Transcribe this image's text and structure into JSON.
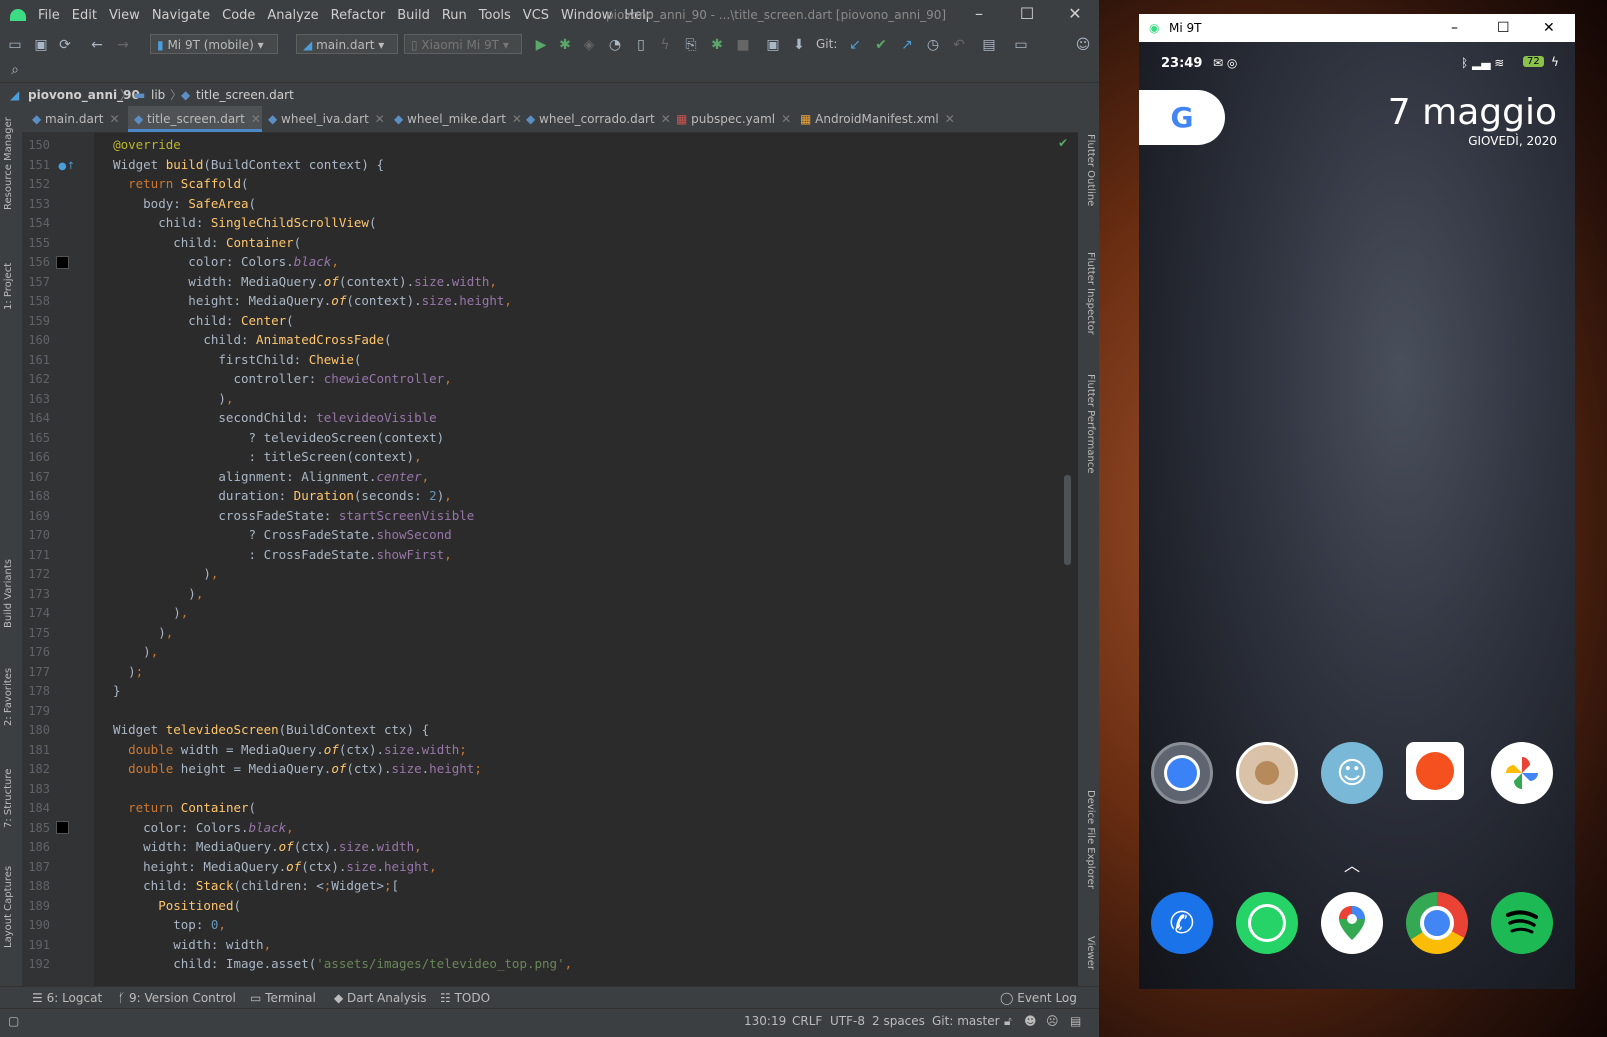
{
  "ide": {
    "menu": [
      "File",
      "Edit",
      "View",
      "Navigate",
      "Code",
      "Analyze",
      "Refactor",
      "Build",
      "Run",
      "Tools",
      "VCS",
      "Window",
      "Help"
    ],
    "window_title": "piovono_anni_90 - ...\\title_screen.dart [piovono_anni_90]",
    "toolbar": {
      "device_combo": "Mi 9T (mobile)",
      "config_combo": "main.dart",
      "target_combo": "Xiaomi Mi 9T",
      "git_label": "Git:"
    },
    "breadcrumb": [
      "piovono_anni_90",
      "lib",
      "title_screen.dart"
    ],
    "tabs": [
      {
        "label": "main.dart"
      },
      {
        "label": "title_screen.dart"
      },
      {
        "label": "wheel_iva.dart"
      },
      {
        "label": "wheel_mike.dart"
      },
      {
        "label": "wheel_corrado.dart"
      },
      {
        "label": "pubspec.yaml"
      },
      {
        "label": "AndroidManifest.xml"
      }
    ],
    "left_tools": [
      "Resource Manager",
      "1: Project",
      "Build Variants",
      "2: Favorites",
      "7: Structure",
      "Layout Captures"
    ],
    "right_tools": [
      "Flutter Outline",
      "Flutter Inspector",
      "Flutter Performance",
      "Device File Explorer",
      "Viewer"
    ],
    "bottom_tools": [
      "6: Logcat",
      "9: Version Control",
      "Terminal",
      "Dart Analysis",
      "TODO"
    ],
    "event_log": "Event Log",
    "status": {
      "position": "130:19",
      "line_sep": "CRLF",
      "encoding": "UTF-8",
      "indent": "2 spaces",
      "git": "Git: master"
    },
    "code": [
      {
        "n": "150",
        "t": "  @override"
      },
      {
        "n": "151",
        "t": "  Widget build(BuildContext context) {"
      },
      {
        "n": "152",
        "t": "    return Scaffold("
      },
      {
        "n": "153",
        "t": "      body: SafeArea("
      },
      {
        "n": "154",
        "t": "        child: SingleChildScrollView("
      },
      {
        "n": "155",
        "t": "          child: Container("
      },
      {
        "n": "156",
        "t": "            color: Colors.black,"
      },
      {
        "n": "157",
        "t": "            width: MediaQuery.of(context).size.width,"
      },
      {
        "n": "158",
        "t": "            height: MediaQuery.of(context).size.height,"
      },
      {
        "n": "159",
        "t": "            child: Center("
      },
      {
        "n": "160",
        "t": "              child: AnimatedCrossFade("
      },
      {
        "n": "161",
        "t": "                firstChild: Chewie("
      },
      {
        "n": "162",
        "t": "                  controller: chewieController,"
      },
      {
        "n": "163",
        "t": "                ),"
      },
      {
        "n": "164",
        "t": "                secondChild: televideoVisible"
      },
      {
        "n": "165",
        "t": "                    ? televideoScreen(context)"
      },
      {
        "n": "166",
        "t": "                    : titleScreen(context),"
      },
      {
        "n": "167",
        "t": "                alignment: Alignment.center,"
      },
      {
        "n": "168",
        "t": "                duration: Duration(seconds: 2),"
      },
      {
        "n": "169",
        "t": "                crossFadeState: startScreenVisible"
      },
      {
        "n": "170",
        "t": "                    ? CrossFadeState.showSecond"
      },
      {
        "n": "171",
        "t": "                    : CrossFadeState.showFirst,"
      },
      {
        "n": "172",
        "t": "              ),"
      },
      {
        "n": "173",
        "t": "            ),"
      },
      {
        "n": "174",
        "t": "          ),"
      },
      {
        "n": "175",
        "t": "        ),"
      },
      {
        "n": "176",
        "t": "      ),"
      },
      {
        "n": "177",
        "t": "    );"
      },
      {
        "n": "178",
        "t": "  }"
      },
      {
        "n": "179",
        "t": ""
      },
      {
        "n": "180",
        "t": "  Widget televideoScreen(BuildContext ctx) {"
      },
      {
        "n": "181",
        "t": "    double width = MediaQuery.of(ctx).size.width;"
      },
      {
        "n": "182",
        "t": "    double height = MediaQuery.of(ctx).size.height;"
      },
      {
        "n": "183",
        "t": ""
      },
      {
        "n": "184",
        "t": "    return Container("
      },
      {
        "n": "185",
        "t": "      color: Colors.black,"
      },
      {
        "n": "186",
        "t": "      width: MediaQuery.of(ctx).size.width,"
      },
      {
        "n": "187",
        "t": "      height: MediaQuery.of(ctx).size.height,"
      },
      {
        "n": "188",
        "t": "      child: Stack(children: <Widget>["
      },
      {
        "n": "189",
        "t": "        Positioned("
      },
      {
        "n": "190",
        "t": "          top: 0,"
      },
      {
        "n": "191",
        "t": "          width: width,"
      },
      {
        "n": "192",
        "t": "          child: Image.asset('assets/images/televideo_top.png',"
      }
    ]
  },
  "phone": {
    "window_title": "Mi 9T",
    "time": "23:49",
    "battery": "72",
    "date": "7 maggio",
    "day": "GIOVEDÌ, 2020",
    "google_label": "G",
    "apps_row1": [
      "camera-icon",
      "contact-icon",
      "waze-icon",
      "recorder-icon",
      "photos-icon"
    ],
    "apps_dock": [
      "phone-icon",
      "whatsapp-icon",
      "maps-icon",
      "chrome-icon",
      "spotify-icon"
    ]
  },
  "colors": {
    "accent": "#4a88c7",
    "editor_bg": "#2b2b2b",
    "panel_bg": "#3c3f41"
  }
}
